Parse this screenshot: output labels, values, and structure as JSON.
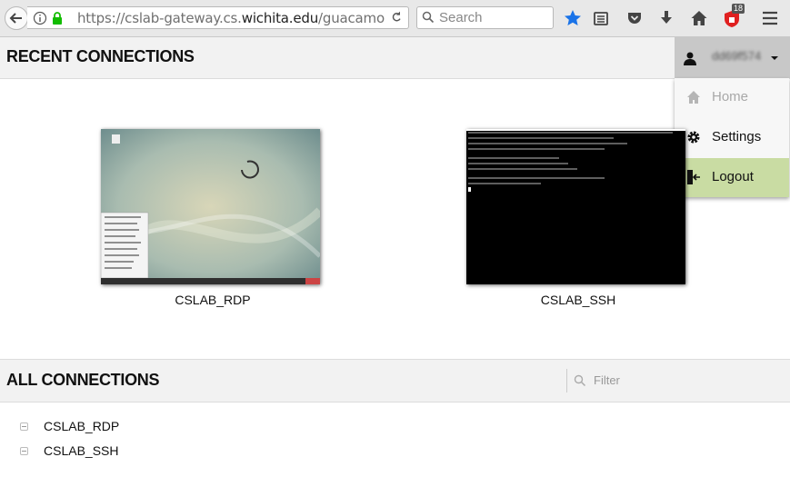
{
  "browser": {
    "url_prefix": "https://cslab-gateway.cs.",
    "url_host": "wichita.edu",
    "url_suffix": "/guacamo",
    "search_placeholder": "Search",
    "badge_count": "18"
  },
  "recent": {
    "title": "RECENT CONNECTIONS",
    "items": [
      {
        "label": "CSLAB_RDP"
      },
      {
        "label": "CSLAB_SSH"
      }
    ]
  },
  "user_menu": {
    "username": "dd69f574",
    "items": [
      {
        "label": "Home",
        "icon": "home-icon"
      },
      {
        "label": "Settings",
        "icon": "gear-icon"
      },
      {
        "label": "Logout",
        "icon": "logout-icon"
      }
    ]
  },
  "all": {
    "title": "ALL CONNECTIONS",
    "filter_placeholder": "Filter",
    "items": [
      {
        "label": "CSLAB_RDP"
      },
      {
        "label": "CSLAB_SSH"
      }
    ]
  },
  "colors": {
    "active_menu": "#c9dca3",
    "header_bg": "#f2f2f2",
    "bookmark_star": "#1a73e8"
  }
}
